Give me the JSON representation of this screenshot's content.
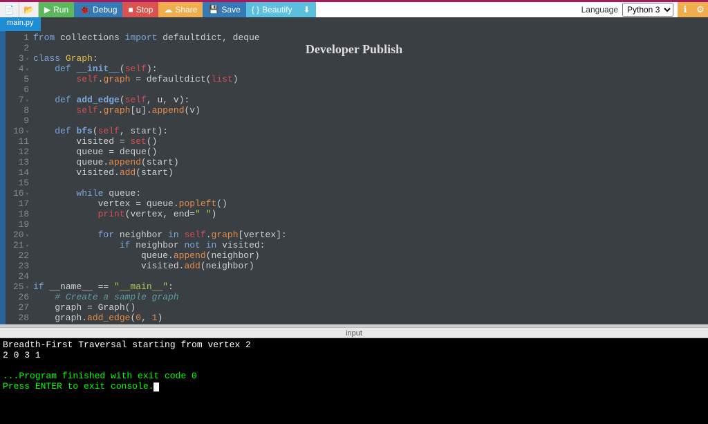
{
  "toolbar": {
    "run": "Run",
    "debug": "Debug",
    "stop": "Stop",
    "share": "Share",
    "save": "Save",
    "beautify": "Beautify",
    "language_label": "Language",
    "language_value": "Python 3"
  },
  "tab": {
    "name": "main.py"
  },
  "watermark": "Developer Publish",
  "gutter_lines": [
    "1",
    "2",
    "3",
    "4",
    "5",
    "6",
    "7",
    "8",
    "9",
    "10",
    "11",
    "12",
    "13",
    "14",
    "15",
    "16",
    "17",
    "18",
    "19",
    "20",
    "21",
    "22",
    "23",
    "24",
    "25",
    "26",
    "27",
    "28"
  ],
  "fold_lines": [
    3,
    4,
    7,
    10,
    16,
    20,
    21,
    25
  ],
  "code": [
    [
      [
        "kw",
        "from"
      ],
      [
        "plain",
        " collections "
      ],
      [
        "kw",
        "import"
      ],
      [
        "plain",
        " defaultdict, deque"
      ]
    ],
    [],
    [
      [
        "kw",
        "class"
      ],
      [
        "plain",
        " "
      ],
      [
        "cls",
        "Graph"
      ],
      [
        "plain",
        ":"
      ]
    ],
    [
      [
        "plain",
        "    "
      ],
      [
        "kw",
        "def"
      ],
      [
        "plain",
        " "
      ],
      [
        "fn",
        "__init__"
      ],
      [
        "plain",
        "("
      ],
      [
        "self",
        "self"
      ],
      [
        "plain",
        "):"
      ]
    ],
    [
      [
        "plain",
        "        "
      ],
      [
        "self",
        "self"
      ],
      [
        "plain",
        "."
      ],
      [
        "attr",
        "graph"
      ],
      [
        "plain",
        " = defaultdict("
      ],
      [
        "builtin",
        "list"
      ],
      [
        "plain",
        ")"
      ]
    ],
    [],
    [
      [
        "plain",
        "    "
      ],
      [
        "kw",
        "def"
      ],
      [
        "plain",
        " "
      ],
      [
        "fn",
        "add_edge"
      ],
      [
        "plain",
        "("
      ],
      [
        "self",
        "self"
      ],
      [
        "plain",
        ", u, v):"
      ]
    ],
    [
      [
        "plain",
        "        "
      ],
      [
        "self",
        "self"
      ],
      [
        "plain",
        "."
      ],
      [
        "attr",
        "graph"
      ],
      [
        "plain",
        "[u]."
      ],
      [
        "attr",
        "append"
      ],
      [
        "plain",
        "(v)"
      ]
    ],
    [],
    [
      [
        "plain",
        "    "
      ],
      [
        "kw",
        "def"
      ],
      [
        "plain",
        " "
      ],
      [
        "fn",
        "bfs"
      ],
      [
        "plain",
        "("
      ],
      [
        "self",
        "self"
      ],
      [
        "plain",
        ", start):"
      ]
    ],
    [
      [
        "plain",
        "        visited = "
      ],
      [
        "builtin",
        "set"
      ],
      [
        "plain",
        "()"
      ]
    ],
    [
      [
        "plain",
        "        queue = deque()"
      ]
    ],
    [
      [
        "plain",
        "        queue."
      ],
      [
        "attr",
        "append"
      ],
      [
        "plain",
        "(start)"
      ]
    ],
    [
      [
        "plain",
        "        visited."
      ],
      [
        "attr",
        "add"
      ],
      [
        "plain",
        "(start)"
      ]
    ],
    [],
    [
      [
        "plain",
        "        "
      ],
      [
        "kw",
        "while"
      ],
      [
        "plain",
        " queue:"
      ]
    ],
    [
      [
        "plain",
        "            vertex = queue."
      ],
      [
        "attr",
        "popleft"
      ],
      [
        "plain",
        "()"
      ]
    ],
    [
      [
        "plain",
        "            "
      ],
      [
        "builtin",
        "print"
      ],
      [
        "plain",
        "(vertex, end="
      ],
      [
        "str",
        "\" \""
      ],
      [
        "plain",
        ")"
      ]
    ],
    [],
    [
      [
        "plain",
        "            "
      ],
      [
        "kw",
        "for"
      ],
      [
        "plain",
        " neighbor "
      ],
      [
        "kw",
        "in"
      ],
      [
        "plain",
        " "
      ],
      [
        "self",
        "self"
      ],
      [
        "plain",
        "."
      ],
      [
        "attr",
        "graph"
      ],
      [
        "plain",
        "[vertex]:"
      ]
    ],
    [
      [
        "plain",
        "                "
      ],
      [
        "kw",
        "if"
      ],
      [
        "plain",
        " neighbor "
      ],
      [
        "kw",
        "not in"
      ],
      [
        "plain",
        " visited:"
      ]
    ],
    [
      [
        "plain",
        "                    queue."
      ],
      [
        "attr",
        "append"
      ],
      [
        "plain",
        "(neighbor)"
      ]
    ],
    [
      [
        "plain",
        "                    visited."
      ],
      [
        "attr",
        "add"
      ],
      [
        "plain",
        "(neighbor)"
      ]
    ],
    [],
    [
      [
        "kw",
        "if"
      ],
      [
        "plain",
        " __name__ == "
      ],
      [
        "str",
        "\"__main__\""
      ],
      [
        "plain",
        ":"
      ]
    ],
    [
      [
        "plain",
        "    "
      ],
      [
        "cmt",
        "# Create a sample graph"
      ]
    ],
    [
      [
        "plain",
        "    graph = Graph()"
      ]
    ],
    [
      [
        "plain",
        "    graph."
      ],
      [
        "attr",
        "add_edge"
      ],
      [
        "plain",
        "("
      ],
      [
        "num",
        "0"
      ],
      [
        "plain",
        ", "
      ],
      [
        "num",
        "1"
      ],
      [
        "plain",
        ")"
      ]
    ]
  ],
  "input_label": "input",
  "console": {
    "line1": "Breadth-First Traversal starting from vertex 2",
    "line2": "2 0 3 1 ",
    "line3": "",
    "line4": "...Program finished with exit code 0",
    "line5": "Press ENTER to exit console."
  }
}
